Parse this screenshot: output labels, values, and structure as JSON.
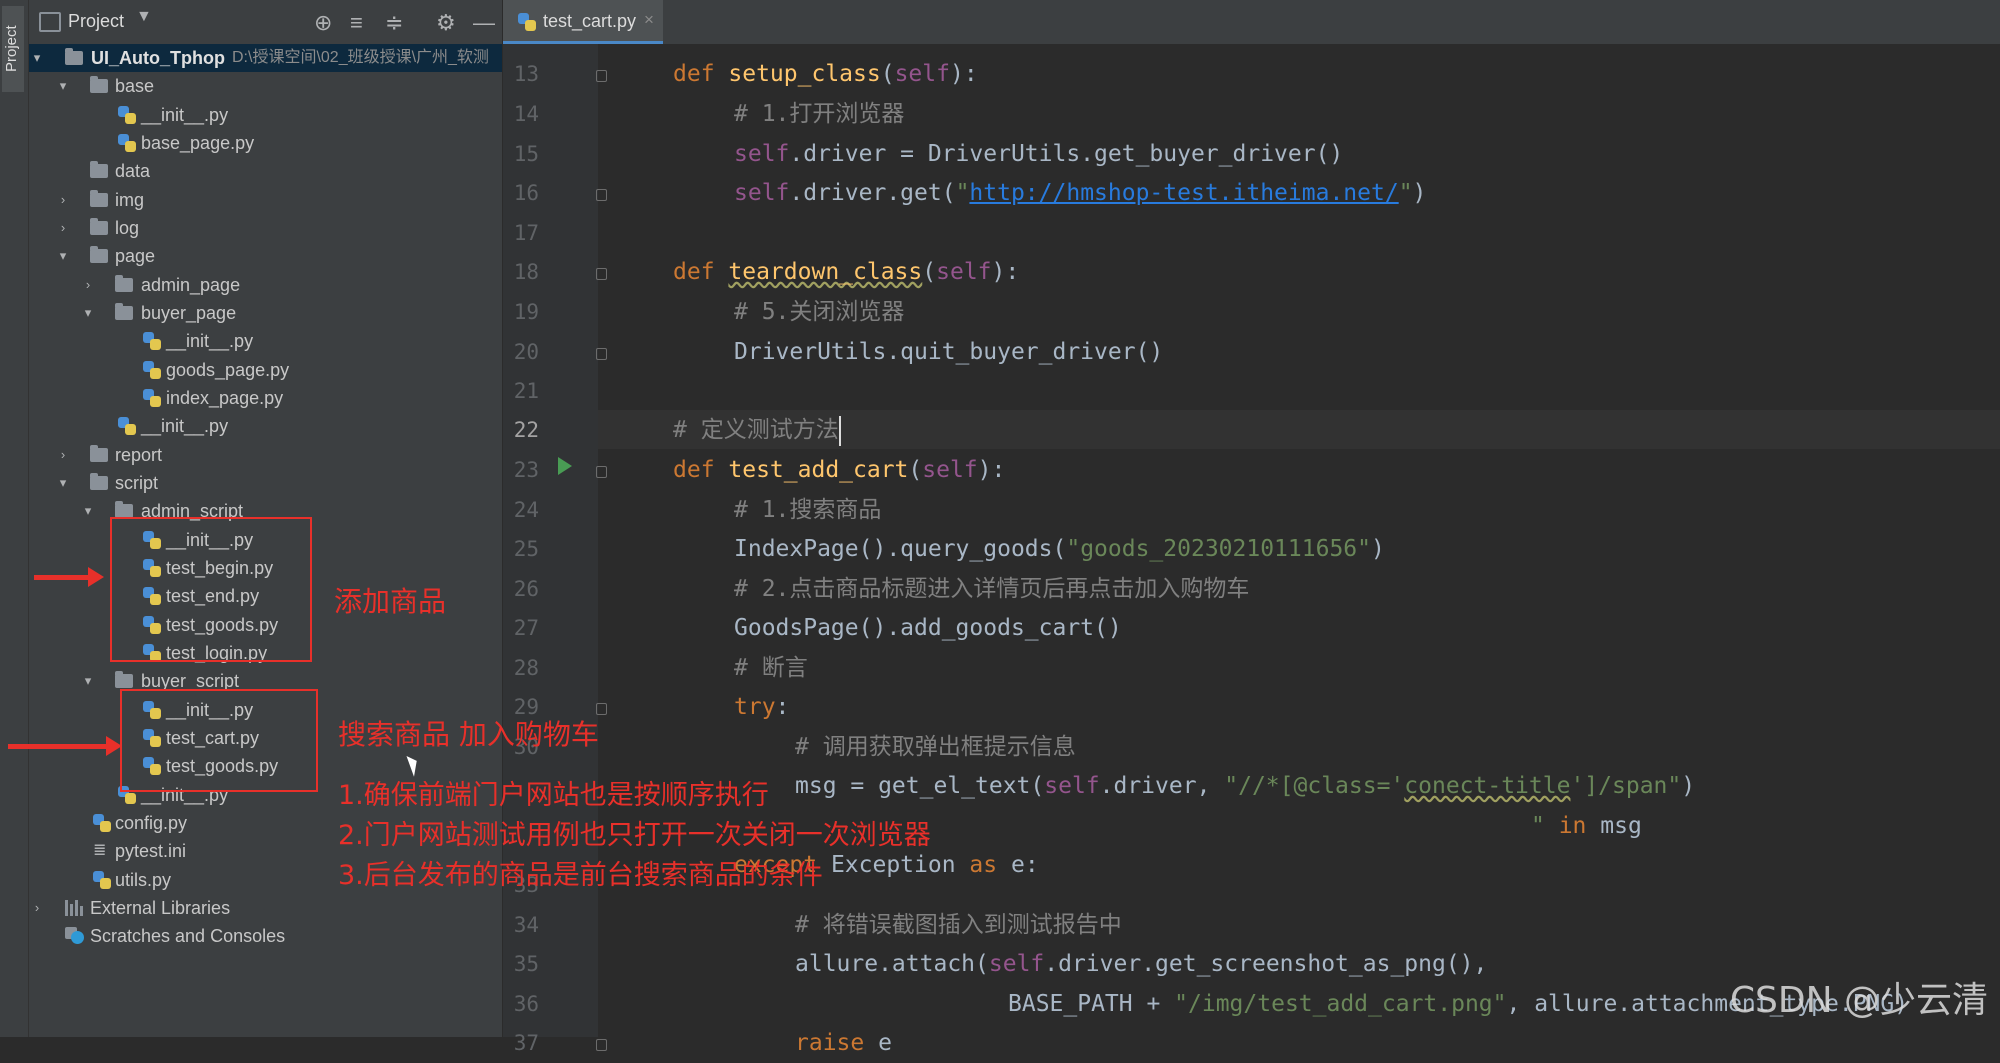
{
  "side_strip": {
    "project_tab": "Project"
  },
  "project_panel": {
    "title": "Project",
    "root": {
      "name": "UI_Auto_Tphop",
      "path": "D:\\授课空间\\02_班级授课\\广州_软测"
    },
    "items": [
      {
        "label": "base"
      },
      {
        "label": "__init__.py"
      },
      {
        "label": "base_page.py"
      },
      {
        "label": "data"
      },
      {
        "label": "img"
      },
      {
        "label": "log"
      },
      {
        "label": "page"
      },
      {
        "label": "admin_page"
      },
      {
        "label": "buyer_page"
      },
      {
        "label": "__init__.py"
      },
      {
        "label": "goods_page.py"
      },
      {
        "label": "index_page.py"
      },
      {
        "label": "__init__.py"
      },
      {
        "label": "report"
      },
      {
        "label": "script"
      },
      {
        "label": "admin_script"
      },
      {
        "label": "__init__.py"
      },
      {
        "label": "test_begin.py"
      },
      {
        "label": "test_end.py"
      },
      {
        "label": "test_goods.py"
      },
      {
        "label": "test_login.py"
      },
      {
        "label": "buyer_script"
      },
      {
        "label": "__init__.py"
      },
      {
        "label": "test_cart.py"
      },
      {
        "label": "test_goods.py"
      },
      {
        "label": "__init__.py"
      },
      {
        "label": "config.py"
      },
      {
        "label": "pytest.ini"
      },
      {
        "label": "utils.py"
      },
      {
        "label": "External Libraries"
      },
      {
        "label": "Scratches and Consoles"
      }
    ]
  },
  "editor": {
    "tab": {
      "name": "test_cart.py",
      "close": "×"
    },
    "line_numbers": [
      "13",
      "14",
      "15",
      "16",
      "17",
      "18",
      "19",
      "20",
      "21",
      "22",
      "23",
      "24",
      "25",
      "26",
      "27",
      "28",
      "29",
      "30",
      "33",
      "34",
      "35",
      "36",
      "37"
    ],
    "code": {
      "l13_kw": "def ",
      "l13_fn": "setup_class",
      "l13_a": "(",
      "l13_self": "self",
      "l13_b": "):",
      "l14": "# 1.打开浏览器",
      "l15_self": "self",
      "l15_rest": ".driver = DriverUtils.get_buyer_driver()",
      "l16_self": "self",
      "l16_a": ".driver.get(",
      "l16_q1": "\"",
      "l16_url": "http://hmshop-test.itheima.net/",
      "l16_q2": "\"",
      "l16_b": ")",
      "l18_kw": "def ",
      "l18_fn": "teardown_class",
      "l18_a": "(",
      "l18_self": "self",
      "l18_b": "):",
      "l19": "# 5.关闭浏览器",
      "l20": "DriverUtils.quit_buyer_driver()",
      "l22": "# 定义测试方法",
      "l23_kw": "def ",
      "l23_fn": "test_add_cart",
      "l23_a": "(",
      "l23_self": "self",
      "l23_b": "):",
      "l24": "# 1.搜索商品",
      "l25_a": "IndexPage().query_goods(",
      "l25_str": "\"goods_20230210111656\"",
      "l25_b": ")",
      "l26": "# 2.点击商品标题进入详情页后再点击加入购物车",
      "l27": "GoodsPage().add_goods_cart()",
      "l28": "# 断言",
      "l29_kw": "try",
      "l29_b": ":",
      "l30": "# 调用获取弹出框提示信息",
      "l31_a": "msg = get_el_text(",
      "l31_self": "self",
      "l31_b": ".driver, ",
      "l31_str1": "\"//*[@class='",
      "l31_str2": "conect-title",
      "l31_str3": "']/span\"",
      "l31_c": ")",
      "l32_str": "\"",
      "l32_kw": " in",
      "l32_b": " msg",
      "l33_kw": "except ",
      "l33_a": "Exception ",
      "l33_kw2": "as",
      "l33_b": " e:",
      "l34": "# 将错误截图插入到测试报告中",
      "l35_a": "allure.attach(",
      "l35_self": "self",
      "l35_b": ".driver.get_screenshot_as_png(),",
      "l36_a": "BASE_PATH + ",
      "l36_str": "\"/img/test_add_cart.png\"",
      "l36_b": ", allure.attachment_type.PNG)",
      "l37_kw": "raise",
      "l37_b": " e"
    }
  },
  "annotations": {
    "admin_note": "添加商品",
    "buyer_note": "搜索商品 加入购物车",
    "note1": "1.确保前端门户网站也是按顺序执行",
    "note2": "2.门户网站测试用例也只打开一次关闭一次浏览器",
    "note3": "3.后台发布的商品是前台搜索商品的条件",
    "color": "#e8302a"
  },
  "watermark": "CSDN @少云清"
}
